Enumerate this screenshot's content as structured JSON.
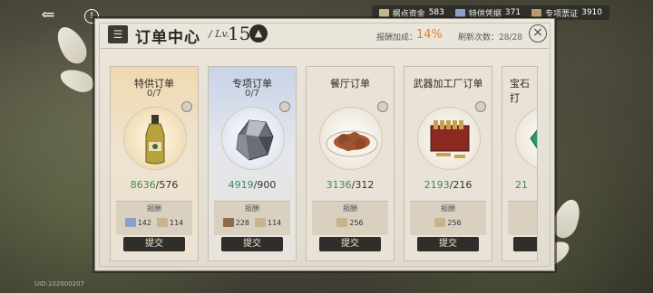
{
  "top_bar": {
    "back_icon": "back-arrow-icon",
    "info_icon": "info-icon",
    "currencies": [
      {
        "label": "据点资金",
        "value": "583",
        "icon": "coin-icon"
      },
      {
        "label": "特供凭据",
        "value": "371",
        "icon": "voucher-icon"
      },
      {
        "label": "专项票证",
        "value": "3910",
        "icon": "ticket-icon"
      }
    ]
  },
  "panel": {
    "title": "订单中心",
    "lv_label": "/ Lv.",
    "level": "15",
    "bonus_label": "报酬加成：",
    "bonus_value": "14%",
    "refresh_label": "刷新次数：28/28",
    "close_symbol": "×"
  },
  "cards": [
    {
      "name": "特供订单",
      "progress": "0/7",
      "item": "olive-oil-bottle",
      "have": "8636",
      "need": "/576",
      "reward_label": "报酬",
      "rewards": [
        {
          "icon": "voucher-icon",
          "value": "142",
          "color": "#8aa0c8"
        },
        {
          "icon": "ticket-icon",
          "value": "114",
          "color": "#c8b48c"
        }
      ],
      "submit": "提交"
    },
    {
      "name": "专项订单",
      "progress": "0/7",
      "item": "silver-ore",
      "have": "4919",
      "need": "/900",
      "reward_label": "报酬",
      "rewards": [
        {
          "icon": "coin-icon",
          "value": "228",
          "color": "#8c6c4a"
        },
        {
          "icon": "ticket-icon",
          "value": "114",
          "color": "#c8b48c"
        }
      ],
      "submit": "提交"
    },
    {
      "name": "餐厅订单",
      "progress": "",
      "item": "meatball-dish",
      "have": "3136",
      "need": "/312",
      "reward_label": "报酬",
      "rewards": [
        {
          "icon": "ticket-icon",
          "value": "256",
          "color": "#c8b48c"
        }
      ],
      "submit": "提交"
    },
    {
      "name": "武器加工厂订单",
      "progress": "",
      "item": "ammo-crate",
      "have": "2193",
      "need": "/216",
      "reward_label": "报酬",
      "rewards": [
        {
          "icon": "ticket-icon",
          "value": "256",
          "color": "#c8b48c"
        }
      ],
      "submit": "提交"
    },
    {
      "name": "宝石打",
      "progress": "",
      "item": "green-gem",
      "have": "21",
      "need": "",
      "reward_label": "",
      "rewards": [],
      "submit": ""
    }
  ],
  "uid": "UID:102000207",
  "colors": {
    "accent": "#d9833a",
    "have_green": "#3e8a5a",
    "button_dark": "#2f2e2b"
  }
}
